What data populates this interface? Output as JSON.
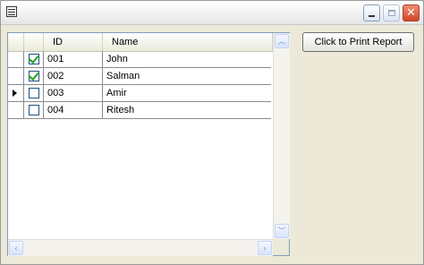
{
  "window": {
    "title": "",
    "title_buttons": {
      "minimize_icon": "minimize-icon",
      "maximize_icon": "maximize-icon",
      "close_icon": "close-icon"
    }
  },
  "grid": {
    "columns": {
      "id": "ID",
      "name": "Name"
    },
    "rows": [
      {
        "checked": true,
        "current": false,
        "id": "001",
        "name": "John"
      },
      {
        "checked": true,
        "current": false,
        "id": "002",
        "name": "Salman"
      },
      {
        "checked": false,
        "current": true,
        "id": "003",
        "name": "Amir"
      },
      {
        "checked": false,
        "current": false,
        "id": "004",
        "name": "Ritesh"
      }
    ]
  },
  "actions": {
    "print_report_label": "Click to Print Report"
  },
  "colors": {
    "checkmark": "#21a121",
    "close_button": "#d2452a",
    "grid_border": "#7f9db9"
  }
}
